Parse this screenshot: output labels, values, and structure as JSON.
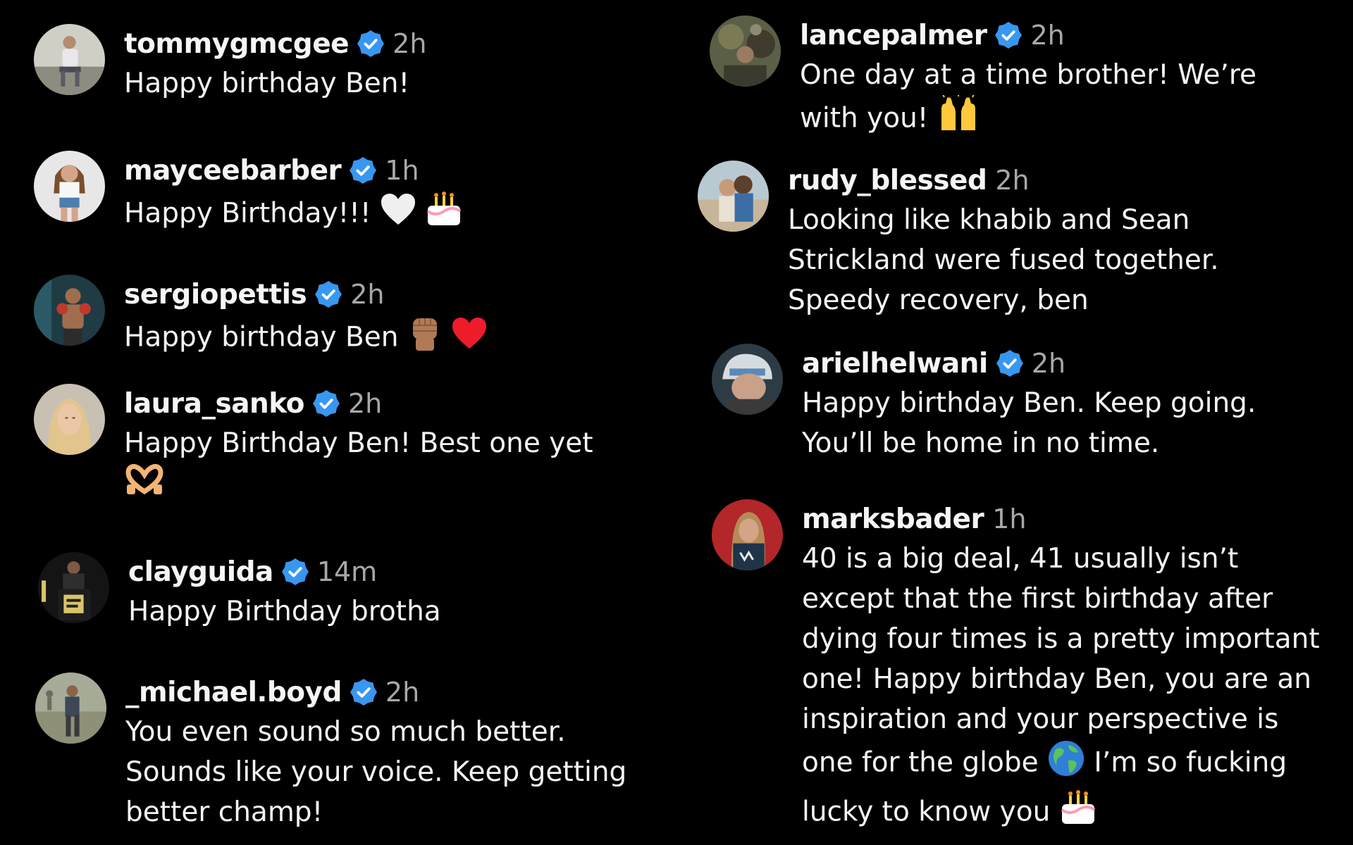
{
  "badge_color": "#3897f0",
  "comments": [
    {
      "username": "tommygmcgee",
      "verified": true,
      "time": "2h",
      "lines": [
        "Happy birthday Ben!"
      ]
    },
    {
      "username": "mayceebarber",
      "verified": true,
      "time": "1h",
      "lines": [
        "Happy Birthday!!!"
      ],
      "emojis": [
        "white-heart-icon",
        "birthday-cake-icon"
      ]
    },
    {
      "username": "sergiopettis",
      "verified": true,
      "time": "2h",
      "lines": [
        "Happy birthday Ben"
      ],
      "emojis": [
        "raised-fist-icon",
        "red-heart-icon"
      ]
    },
    {
      "username": "laura_sanko",
      "verified": true,
      "time": "2h",
      "lines": [
        "Happy Birthday Ben! Best one yet"
      ],
      "emojis": [
        "heart-hands-icon"
      ]
    },
    {
      "username": "clayguida",
      "verified": true,
      "time": "14m",
      "lines": [
        "Happy Birthday brotha"
      ]
    },
    {
      "username": "_michael.boyd",
      "verified": true,
      "time": "2h",
      "lines": [
        "You even sound so much better.",
        "Sounds like your voice. Keep getting",
        "better champ!"
      ]
    },
    {
      "username": "lancepalmer",
      "verified": true,
      "time": "2h",
      "lines": [
        "One day at a time brother! We’re",
        "with you!"
      ],
      "emojis": [
        "raising-hands-icon"
      ]
    },
    {
      "username": "rudy_blessed",
      "verified": false,
      "time": "2h",
      "lines": [
        "Looking like khabib and Sean",
        "Strickland were fused together.",
        "Speedy recovery, ben"
      ]
    },
    {
      "username": "arielhelwani",
      "verified": true,
      "time": "2h",
      "lines": [
        "Happy birthday Ben. Keep going.",
        "You’ll be home in no time."
      ]
    },
    {
      "username": "marksbader",
      "verified": false,
      "time": "1h",
      "lines": [
        "40 is a big deal, 41 usually isn’t",
        "except that the first birthday after",
        "dying four times is a pretty important",
        "one! Happy birthday Ben, you are an",
        "inspiration and your perspective is",
        "one for the globe",
        "I’m so fucking",
        "lucky to know you"
      ],
      "emojis": [
        "globe-icon",
        "birthday-cake-icon"
      ]
    }
  ]
}
